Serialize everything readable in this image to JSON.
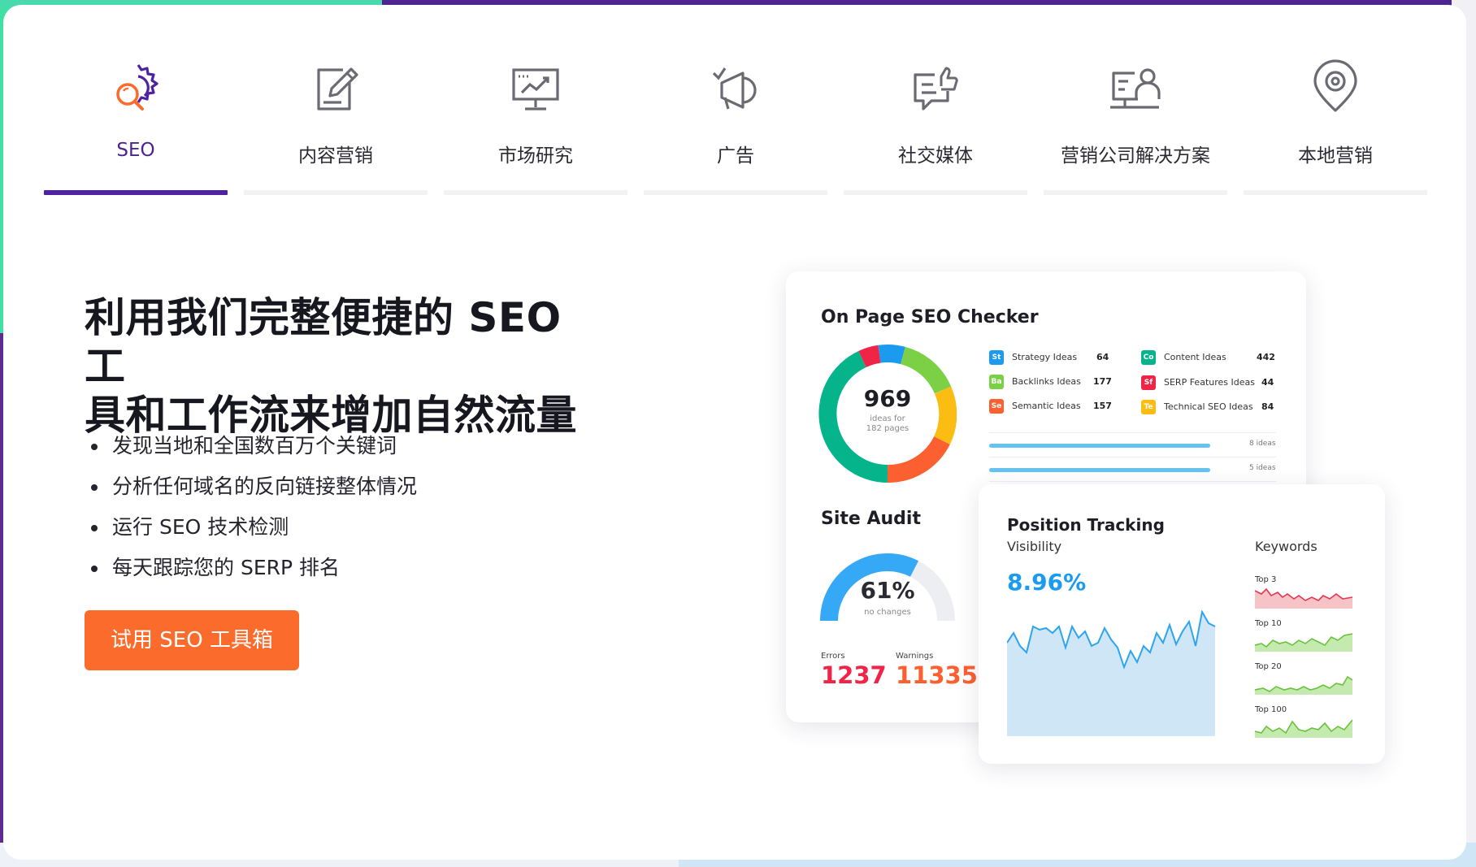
{
  "tabs": [
    {
      "label": "SEO",
      "icon": "seo-gear-search-icon",
      "active": true
    },
    {
      "label": "内容营销",
      "icon": "edit-document-icon",
      "active": false
    },
    {
      "label": "市场研究",
      "icon": "presentation-chart-icon",
      "active": false
    },
    {
      "label": "广告",
      "icon": "megaphone-icon",
      "active": false
    },
    {
      "label": "社交媒体",
      "icon": "chat-like-icon",
      "active": false
    },
    {
      "label": "营销公司解决方案",
      "icon": "presenter-board-icon",
      "active": false
    },
    {
      "label": "本地营销",
      "icon": "location-pin-icon",
      "active": false
    }
  ],
  "hero": {
    "headline_line1": "利用我们完整便捷的 SEO 工",
    "headline_line2": "具和工作流来增加自然流量",
    "bullets": [
      "发现当地和全国数百万个关键词",
      "分析任何域名的反向链接整体情况",
      "运行 SEO 技术检测",
      "每天跟踪您的 SERP 排名"
    ],
    "cta": "试用 SEO 工具箱"
  },
  "onpage": {
    "title": "On Page SEO Checker",
    "total": "969",
    "sub1": "ideas for",
    "sub2": "182 pages",
    "legend": [
      {
        "abbr": "St",
        "name": "Strategy Ideas",
        "value": "64",
        "color": "#1a9bf0"
      },
      {
        "abbr": "Co",
        "name": "Content Ideas",
        "value": "442",
        "color": "#06b48c"
      },
      {
        "abbr": "Ba",
        "name": "Backlinks Ideas",
        "value": "177",
        "color": "#7bd046"
      },
      {
        "abbr": "Sf",
        "name": "SERP Features Ideas",
        "value": "44",
        "color": "#ef2446"
      },
      {
        "abbr": "Se",
        "name": "Semantic Ideas",
        "value": "157",
        "color": "#fd6030"
      },
      {
        "abbr": "Te",
        "name": "Technical SEO Ideas",
        "value": "84",
        "color": "#fbbd12"
      }
    ],
    "bar1_label": "8 ideas",
    "bar2_label": "5 ideas"
  },
  "site_audit": {
    "title": "Site Audit",
    "percent": "61%",
    "percent_value": 61,
    "sub": "no changes",
    "errors_label": "Errors",
    "errors": "1237",
    "warnings_label": "Warnings",
    "warnings": "11335"
  },
  "position": {
    "title": "Position Tracking",
    "visibility_label": "Visibility",
    "visibility": "8.96%",
    "keywords_label": "Keywords",
    "rows": [
      "Top 3",
      "Top 10",
      "Top 20",
      "Top 100"
    ]
  }
}
